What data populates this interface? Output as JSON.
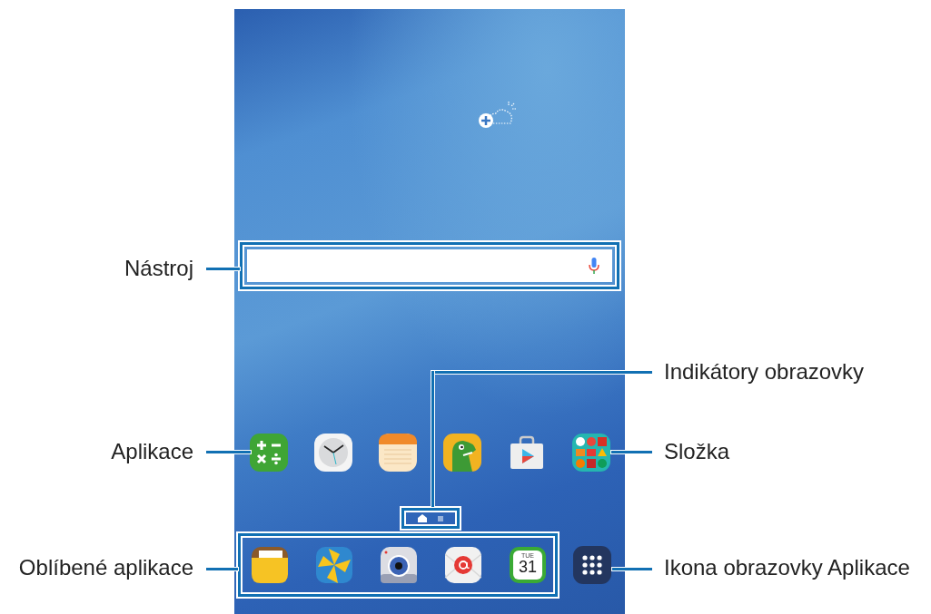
{
  "callouts": [
    {
      "label": "Nástroj"
    },
    {
      "label": "Indikátory obrazovky"
    },
    {
      "label": "Aplikace"
    },
    {
      "label": "Složka"
    },
    {
      "label": "Oblíbené aplikace"
    },
    {
      "label": "Ikona obrazovky Aplikace"
    }
  ],
  "home_apps": [
    {
      "kind": "calculator"
    },
    {
      "kind": "clock"
    },
    {
      "kind": "memo"
    },
    {
      "kind": "dino"
    },
    {
      "kind": "store"
    },
    {
      "kind": "folder"
    }
  ],
  "page_indicators": [
    {
      "kind": "home",
      "selected": true
    },
    {
      "kind": "dot",
      "selected": false
    }
  ],
  "dock_apps": [
    {
      "kind": "files"
    },
    {
      "kind": "gallery"
    },
    {
      "kind": "camera"
    },
    {
      "kind": "email"
    },
    {
      "kind": "calendar"
    }
  ],
  "calendar": {
    "weekday": "TUE",
    "day": "31"
  }
}
